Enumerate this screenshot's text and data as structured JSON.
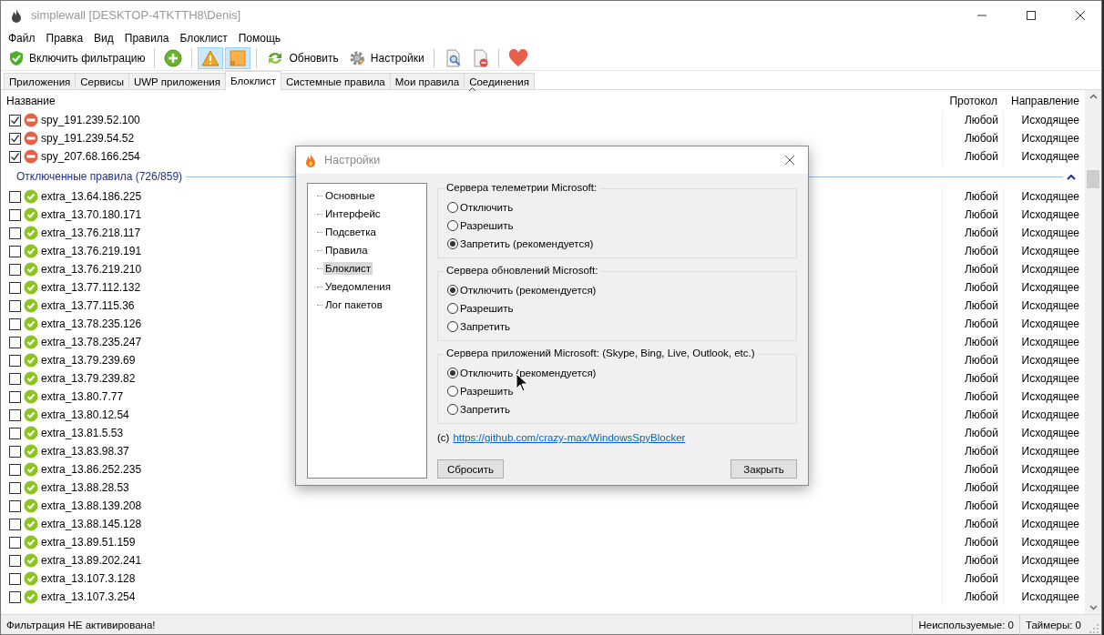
{
  "window": {
    "title": "simplewall [DESKTOP-4TKTTH8\\Denis]"
  },
  "menu": [
    "Файл",
    "Правка",
    "Вид",
    "Правила",
    "Блоклист",
    "Помощь"
  ],
  "toolbar": [
    {
      "kind": "text-button",
      "label": "Включить фильтрацию",
      "pressed": false
    },
    {
      "kind": "separator"
    },
    {
      "kind": "icon-button",
      "pressed": false
    },
    {
      "kind": "separator"
    },
    {
      "kind": "icon-button",
      "pressed": true
    },
    {
      "kind": "icon-button",
      "pressed": true
    },
    {
      "kind": "separator"
    },
    {
      "kind": "text-button",
      "label": "Обновить",
      "pressed": false
    },
    {
      "kind": "text-button",
      "label": "Настройки",
      "pressed": false
    },
    {
      "kind": "separator"
    },
    {
      "kind": "icon-button",
      "pressed": false
    },
    {
      "kind": "icon-button",
      "pressed": false
    },
    {
      "kind": "separator"
    },
    {
      "kind": "icon-button",
      "pressed": false
    }
  ],
  "tabs": [
    {
      "label": "Приложения",
      "selected": false
    },
    {
      "label": "Сервисы",
      "selected": false
    },
    {
      "label": "UWP приложения",
      "selected": false
    },
    {
      "label": "Блоклист",
      "selected": true
    },
    {
      "label": "Системные правила",
      "selected": false
    },
    {
      "label": "Мои правила",
      "selected": false
    },
    {
      "label": "Соединения",
      "selected": false
    }
  ],
  "table": {
    "columns": [
      "Название",
      "Протокол",
      "Направление"
    ],
    "rows": [
      {
        "kind": "row",
        "name": "spy_191.239.52.100",
        "checked": true,
        "protocol": "Любой",
        "direction": "Исходящее"
      },
      {
        "kind": "row",
        "name": "spy_191.239.54.52",
        "checked": true,
        "protocol": "Любой",
        "direction": "Исходящее"
      },
      {
        "kind": "row",
        "name": "spy_207.68.166.254",
        "checked": true,
        "protocol": "Любой",
        "direction": "Исходящее"
      },
      {
        "kind": "group",
        "label": "Отключенные правила (726/859)"
      },
      {
        "kind": "row",
        "name": "extra_13.64.186.225",
        "checked": false,
        "protocol": "Любой",
        "direction": "Исходящее"
      },
      {
        "kind": "row",
        "name": "extra_13.70.180.171",
        "checked": false,
        "protocol": "Любой",
        "direction": "Исходящее"
      },
      {
        "kind": "row",
        "name": "extra_13.76.218.117",
        "checked": false,
        "protocol": "Любой",
        "direction": "Исходящее"
      },
      {
        "kind": "row",
        "name": "extra_13.76.219.191",
        "checked": false,
        "protocol": "Любой",
        "direction": "Исходящее"
      },
      {
        "kind": "row",
        "name": "extra_13.76.219.210",
        "checked": false,
        "protocol": "Любой",
        "direction": "Исходящее"
      },
      {
        "kind": "row",
        "name": "extra_13.77.112.132",
        "checked": false,
        "protocol": "Любой",
        "direction": "Исходящее"
      },
      {
        "kind": "row",
        "name": "extra_13.77.115.36",
        "checked": false,
        "protocol": "Любой",
        "direction": "Исходящее"
      },
      {
        "kind": "row",
        "name": "extra_13.78.235.126",
        "checked": false,
        "protocol": "Любой",
        "direction": "Исходящее"
      },
      {
        "kind": "row",
        "name": "extra_13.78.235.247",
        "checked": false,
        "protocol": "Любой",
        "direction": "Исходящее"
      },
      {
        "kind": "row",
        "name": "extra_13.79.239.69",
        "checked": false,
        "protocol": "Любой",
        "direction": "Исходящее"
      },
      {
        "kind": "row",
        "name": "extra_13.79.239.82",
        "checked": false,
        "protocol": "Любой",
        "direction": "Исходящее"
      },
      {
        "kind": "row",
        "name": "extra_13.80.7.77",
        "checked": false,
        "protocol": "Любой",
        "direction": "Исходящее"
      },
      {
        "kind": "row",
        "name": "extra_13.80.12.54",
        "checked": false,
        "protocol": "Любой",
        "direction": "Исходящее"
      },
      {
        "kind": "row",
        "name": "extra_13.81.5.53",
        "checked": false,
        "protocol": "Любой",
        "direction": "Исходящее"
      },
      {
        "kind": "row",
        "name": "extra_13.83.98.37",
        "checked": false,
        "protocol": "Любой",
        "direction": "Исходящее"
      },
      {
        "kind": "row",
        "name": "extra_13.86.252.235",
        "checked": false,
        "protocol": "Любой",
        "direction": "Исходящее"
      },
      {
        "kind": "row",
        "name": "extra_13.88.28.53",
        "checked": false,
        "protocol": "Любой",
        "direction": "Исходящее"
      },
      {
        "kind": "row",
        "name": "extra_13.88.139.208",
        "checked": false,
        "protocol": "Любой",
        "direction": "Исходящее"
      },
      {
        "kind": "row",
        "name": "extra_13.88.145.128",
        "checked": false,
        "protocol": "Любой",
        "direction": "Исходящее"
      },
      {
        "kind": "row",
        "name": "extra_13.89.51.159",
        "checked": false,
        "protocol": "Любой",
        "direction": "Исходящее"
      },
      {
        "kind": "row",
        "name": "extra_13.89.202.241",
        "checked": false,
        "protocol": "Любой",
        "direction": "Исходящее"
      },
      {
        "kind": "row",
        "name": "extra_13.107.3.128",
        "checked": false,
        "protocol": "Любой",
        "direction": "Исходящее"
      },
      {
        "kind": "row",
        "name": "extra_13.107.3.254",
        "checked": false,
        "protocol": "Любой",
        "direction": "Исходящее"
      }
    ]
  },
  "status_bar": [
    "Фильтрация НЕ активирована!",
    "Неиспользуемые: 0",
    "Таймеры: 0"
  ],
  "dialog": {
    "title": "Настройки",
    "nav": [
      {
        "label": "Основные",
        "selected": false
      },
      {
        "label": "Интерфейс",
        "selected": false
      },
      {
        "label": "Подсветка",
        "selected": false
      },
      {
        "label": "Правила",
        "selected": false
      },
      {
        "label": "Блоклист",
        "selected": true
      },
      {
        "label": "Уведомления",
        "selected": false
      },
      {
        "label": "Лог пакетов",
        "selected": false
      }
    ],
    "groups": [
      {
        "title": "Сервера телеметрии Microsoft:",
        "options": [
          {
            "label": "Отключить",
            "selected": false
          },
          {
            "label": "Разрешить",
            "selected": false
          },
          {
            "label": "Запретить (рекомендуется)",
            "selected": true
          }
        ]
      },
      {
        "title": "Сервера обновлений Microsoft:",
        "options": [
          {
            "label": "Отключить (рекомендуется)",
            "selected": true
          },
          {
            "label": "Разрешить",
            "selected": false
          },
          {
            "label": "Запретить",
            "selected": false
          }
        ]
      },
      {
        "title": "Сервера приложений Microsoft: (Skype, Bing, Live, Outlook, etc.)",
        "options": [
          {
            "label": "Отключить (рекомендуется)",
            "selected": true
          },
          {
            "label": "Разрешить",
            "selected": false
          },
          {
            "label": "Запретить",
            "selected": false
          }
        ]
      }
    ],
    "credit_prefix": "(c)",
    "credit_link": "https://github.com/crazy-max/WindowsSpyBlocker",
    "buttons": [
      "Сбросить",
      "Закрыть"
    ]
  }
}
